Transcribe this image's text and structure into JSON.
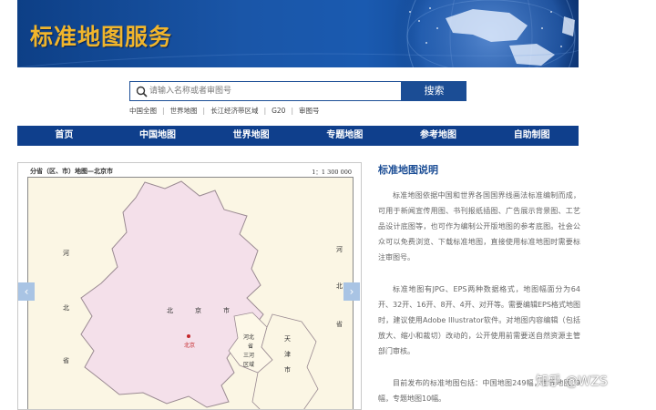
{
  "header": {
    "title": "标准地图服务"
  },
  "search": {
    "placeholder": "请输入名称或者审图号",
    "button_label": "搜索"
  },
  "quick_links": [
    "中国全图",
    "世界地图",
    "长江经济带区域",
    "G20",
    "审图号"
  ],
  "nav": {
    "items": [
      "首页",
      "中国地图",
      "世界地图",
      "专题地图",
      "参考地图",
      "自助制图"
    ]
  },
  "map": {
    "title": "分省（区、市）地图—北京市",
    "scale": "1：1 300 000",
    "labels": {
      "hebei_left_1": "河",
      "hebei_left_2": "北",
      "hebei_left_3": "省",
      "hebei_right_1": "河",
      "hebei_right_2": "北",
      "hebei_right_3": "省",
      "beijing_1": "北",
      "beijing_2": "京",
      "beijing_3": "市",
      "capital": "北京",
      "tianjin_1": "天",
      "tianjin_2": "津",
      "tianjin_3": "市",
      "hebei_mid_1": "河北",
      "hebei_mid_2": "省",
      "hebei_mid_3": "三河",
      "hebei_mid_4": "区域"
    },
    "colors": {
      "beijing_fill": "#f4e0ea",
      "neighbor_fill": "#fbf6e4",
      "tianjin_fill": "#fbf6e4"
    }
  },
  "description": {
    "title": "标准地图说明",
    "paragraphs": [
      "标准地图依据中国和世界各国国界线画法标准编制而成，可用于新闻宣传用图、书刊报纸插图、广告展示背景图、工艺品设计底图等，也可作为编制公开版地图的参考底图。社会公众可以免费浏览、下载标准地图，直接使用标准地图时需要标注审图号。",
      "标准地图有JPG、EPS两种数据格式，地图幅面分为64开、32开、16开、8开、4开、对开等。需要编辑EPS格式地图时，建议使用Adobe Illustrator软件。对地图内容编辑（包括放大、缩小和裁切）改动的，公开使用前需要送自然资源主管部门审核。",
      "目前发布的标准地图包括：中国地图249幅，世界地图79幅，专题地图10幅。"
    ]
  },
  "carousel": {
    "prev_icon": "chevron-left-icon",
    "next_icon": "chevron-right-icon"
  },
  "watermark": "知乎 @WZS",
  "colors": {
    "brand_blue": "#1b4d95",
    "nav_blue": "#0f3f8c",
    "title_gold": "#f0b52c"
  }
}
